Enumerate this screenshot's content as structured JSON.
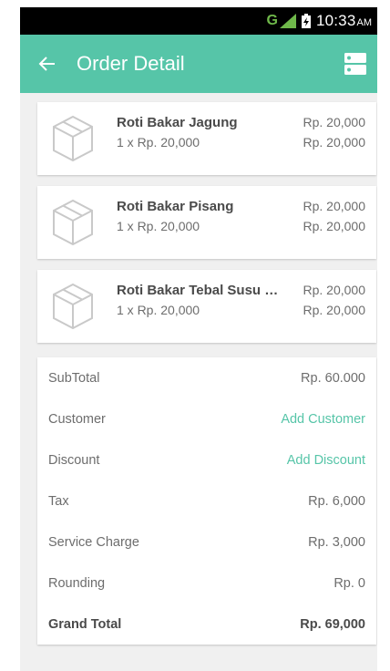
{
  "status_bar": {
    "network": "G",
    "time": "10:33",
    "ampm": "AM"
  },
  "app_bar": {
    "title": "Order Detail",
    "back_icon": "arrow-left-icon",
    "menu_icon": "server-list-icon",
    "color": "#56c5a8"
  },
  "items": [
    {
      "name": "Roti Bakar Jagung",
      "qty_line": "1 x Rp. 20,000",
      "price": "Rp. 20,000",
      "total": "Rp. 20,000",
      "icon": "package-box-icon"
    },
    {
      "name": "Roti Bakar Pisang",
      "qty_line": "1 x Rp. 20,000",
      "price": "Rp. 20,000",
      "total": "Rp. 20,000",
      "icon": "package-box-icon"
    },
    {
      "name": "Roti Bakar Tebal Susu +...",
      "qty_line": "1 x Rp. 20,000",
      "price": "Rp. 20,000",
      "total": "Rp. 20,000",
      "icon": "package-box-icon"
    }
  ],
  "summary": {
    "subtotal_label": "SubTotal",
    "subtotal_value": "Rp. 60.000",
    "customer_label": "Customer",
    "customer_action": "Add Customer",
    "discount_label": "Discount",
    "discount_action": "Add Discount",
    "tax_label": "Tax",
    "tax_value": "Rp. 6,000",
    "service_label": "Service Charge",
    "service_value": "Rp. 3,000",
    "rounding_label": "Rounding",
    "rounding_value": "Rp. 0",
    "grand_label": "Grand Total",
    "grand_value": "Rp. 69,000"
  }
}
